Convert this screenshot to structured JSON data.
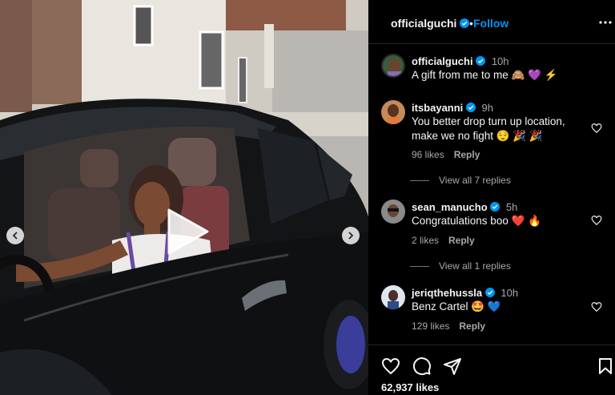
{
  "post": {
    "author": "officialguchi",
    "follow_label": "Follow",
    "dot": "•",
    "caption_time": "10h",
    "caption": "A gift from me to me 🙈 💜 ⚡"
  },
  "comments": [
    {
      "username": "itsbayanni",
      "time": "9h",
      "text": "You better drop turn up location, make we no fight 😌 🎉 🎉",
      "likes": "96 likes",
      "reply_label": "Reply",
      "view_replies": "View all 7 replies"
    },
    {
      "username": "sean_manucho",
      "time": "5h",
      "text": "Congratulations boo ❤️ 🔥",
      "likes": "2 likes",
      "reply_label": "Reply",
      "view_replies": "View all 1 replies"
    },
    {
      "username": "jeriqthehussla",
      "time": "10h",
      "text": "Benz Cartel 🤩 💙",
      "likes": "129 likes",
      "reply_label": "Reply"
    }
  ],
  "footer": {
    "likes_count": "62,937 likes"
  },
  "icons": {
    "verified_color": "#0095f6",
    "accent": "#0095f6"
  }
}
